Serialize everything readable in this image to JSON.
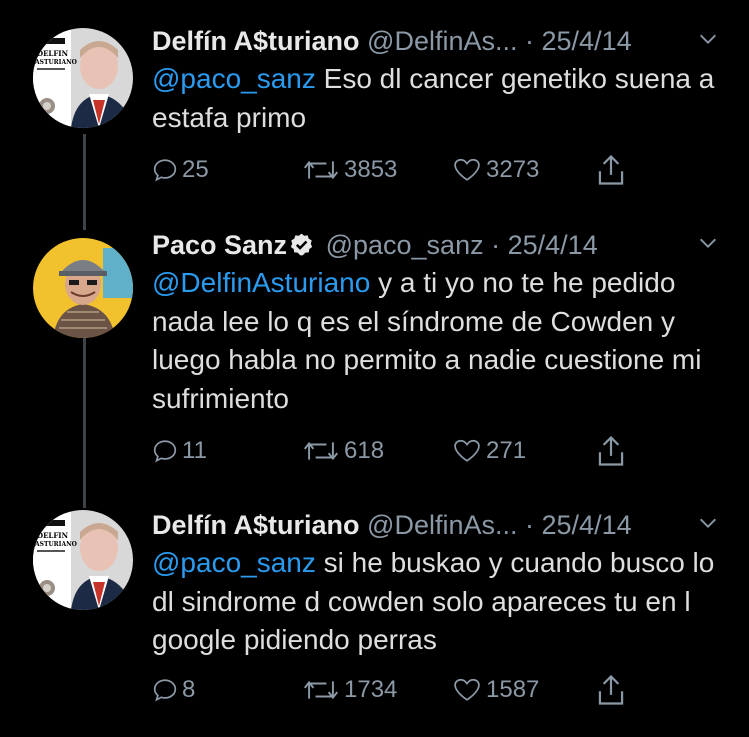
{
  "tweets": [
    {
      "name": "Delfín A$turiano",
      "handle": "@DelfinAs...",
      "separator": "·",
      "date": "25/4/14",
      "verified": false,
      "body_mention": "@paco_sanz",
      "body_text": " Eso dl cancer genetiko suena a estafa primo",
      "replies": "25",
      "retweets": "3853",
      "likes": "3273",
      "avatar_text": [
        "DELFIN",
        "ASTURIANO"
      ]
    },
    {
      "name": "Paco Sanz",
      "handle": "@paco_sanz",
      "separator": "·",
      "date": "25/4/14",
      "verified": true,
      "body_mention": "@DelfinAsturiano",
      "body_text": " y a ti yo no te he pedido nada lee lo q es el síndrome de Cowden y luego habla no permito a nadie cuestione mi sufrimiento",
      "replies": "11",
      "retweets": "618",
      "likes": "271"
    },
    {
      "name": "Delfín A$turiano",
      "handle": "@DelfinAs...",
      "separator": "·",
      "date": "25/4/14",
      "verified": false,
      "body_mention": "@paco_sanz",
      "body_text": " si he buskao y cuando busco lo dl sindrome d cowden solo apareces tu en l google pidiendo perras",
      "replies": "8",
      "retweets": "1734",
      "likes": "1587",
      "avatar_text": [
        "DELFIN",
        "ASTURIANO"
      ]
    }
  ],
  "colors": {
    "background": "#000000",
    "mention": "#2b9bf0",
    "muted": "#8b98a5",
    "thread_line": "#3d4349"
  }
}
